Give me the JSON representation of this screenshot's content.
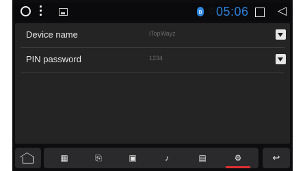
{
  "status_bar": {
    "time": "05:06",
    "icons": [
      "circle-icon",
      "more-vert-icon",
      "image-icon",
      "bluetooth-icon",
      "heart-icon",
      "square-icon",
      "back-triangle-icon"
    ],
    "time_color": "#2b7fd8"
  },
  "settings": [
    {
      "label": "Device name",
      "value": "iTopWayz"
    },
    {
      "label": "PIN password",
      "value": "1234"
    }
  ],
  "bottom_nav": {
    "home_icon": "home-icon",
    "tabs": [
      {
        "icon": "keypad-icon",
        "glyph": "▦"
      },
      {
        "icon": "call-log-icon",
        "glyph": "⎘"
      },
      {
        "icon": "contacts-icon",
        "glyph": "▣"
      },
      {
        "icon": "music-icon",
        "glyph": "♪"
      },
      {
        "icon": "phone-device-icon",
        "glyph": "▤"
      },
      {
        "icon": "settings-gear-icon",
        "glyph": "⚙"
      }
    ],
    "active_tab": 5,
    "back_icon": "return-arrow-icon",
    "back_glyph": "↩",
    "accent_color": "#e03030"
  }
}
